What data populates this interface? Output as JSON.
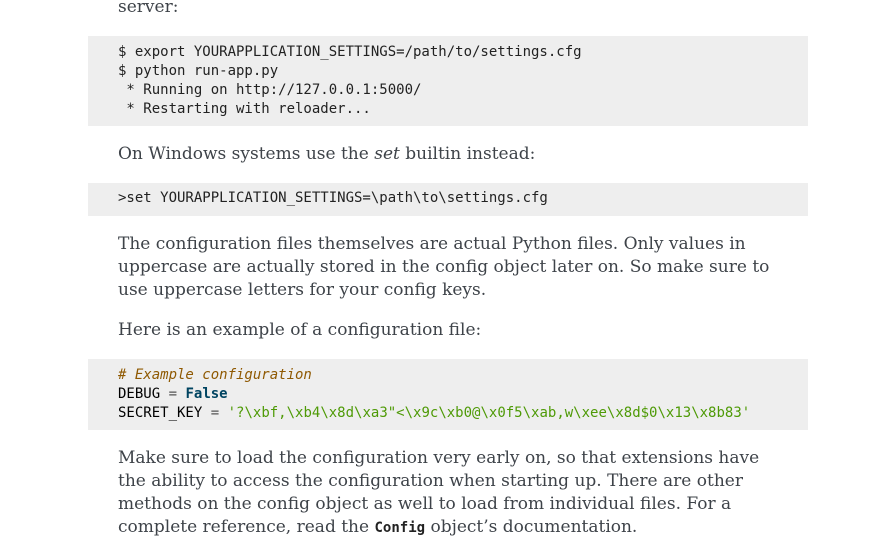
{
  "intro_tail": "server:",
  "shell_block": {
    "lines": [
      "$ export YOURAPPLICATION_SETTINGS=/path/to/settings.cfg",
      "$ python run-app.py",
      " * Running on http://127.0.0.1:5000/",
      " * Restarting with reloader..."
    ]
  },
  "windows_para": {
    "before": "On Windows systems use the ",
    "em": "set",
    "after": " builtin instead:"
  },
  "windows_block": {
    "line": ">set YOURAPPLICATION_SETTINGS=\\path\\to\\settings.cfg"
  },
  "config_files_para": "The configuration files themselves are actual Python files. Only values in uppercase are actually stored in the config object later on. So make sure to use uppercase letters for your config keys.",
  "example_intro": "Here is an example of a configuration file:",
  "config_example": {
    "comment": "# Example configuration",
    "debug_name": "DEBUG",
    "eq": "=",
    "debug_value": "False",
    "secret_name": "SECRET_KEY",
    "secret_value": "'?\\xbf,\\xb4\\x8d\\xa3\"<\\x9c\\xb0@\\x0f5\\xab,w\\xee\\x8d$0\\x13\\x8b83'"
  },
  "final_para": {
    "before": "Make sure to load the configuration very early on, so that extensions have the ability to access the configuration when starting up. There are other methods on the config object as well to load from individual files. For a complete reference, read the ",
    "code": "Config",
    "after": " object’s documentation."
  }
}
